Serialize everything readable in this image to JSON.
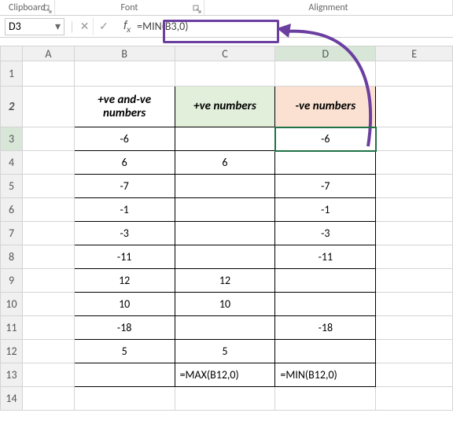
{
  "ribbon": {
    "clipboard": "Clipboard",
    "font": "Font",
    "alignment": "Alignment"
  },
  "namebox": {
    "value": "D3"
  },
  "fx": {
    "label": "fx",
    "formula": "=MIN(B3,0)"
  },
  "columns": [
    "A",
    "B",
    "C",
    "D",
    "E"
  ],
  "active": {
    "col": "D",
    "row": 3
  },
  "headers": {
    "B": "+ve and-ve numbers",
    "C": "+ve numbers",
    "D": "-ve numbers"
  },
  "rows": [
    {
      "n": 3,
      "B": "-6",
      "C": "",
      "D": "-6"
    },
    {
      "n": 4,
      "B": "6",
      "C": "6",
      "D": ""
    },
    {
      "n": 5,
      "B": "-7",
      "C": "",
      "D": "-7"
    },
    {
      "n": 6,
      "B": "-1",
      "C": "",
      "D": "-1"
    },
    {
      "n": 7,
      "B": "-3",
      "C": "",
      "D": "-3"
    },
    {
      "n": 8,
      "B": "-11",
      "C": "",
      "D": "-11"
    },
    {
      "n": 9,
      "B": "12",
      "C": "12",
      "D": ""
    },
    {
      "n": 10,
      "B": "10",
      "C": "10",
      "D": ""
    },
    {
      "n": 11,
      "B": "-18",
      "C": "",
      "D": "-18"
    },
    {
      "n": 12,
      "B": "5",
      "C": "5",
      "D": ""
    }
  ],
  "formula_row": {
    "n": 13,
    "C": "=MAX(B12,0)",
    "D": "=MIN(B12,0)"
  },
  "colors": {
    "highlight": "#6b3fa0",
    "header_green": "#e2efdb",
    "header_orange": "#fbe1d1"
  }
}
